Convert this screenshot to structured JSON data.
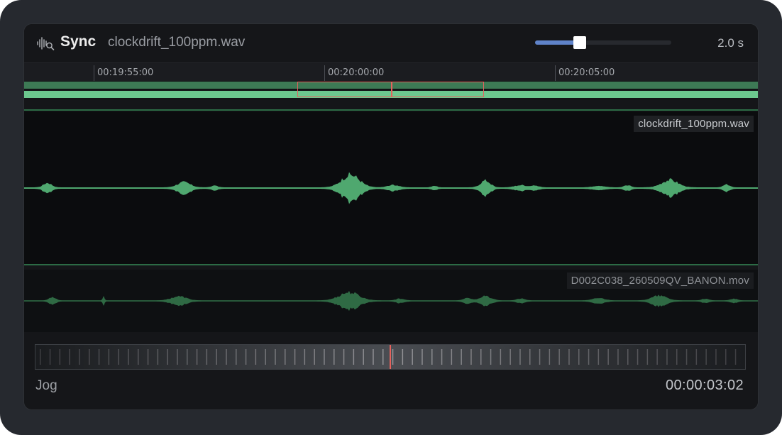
{
  "header": {
    "icon": "waveform-search-icon",
    "title": "Sync",
    "filename": "clockdrift_100ppm.wav",
    "zoom_value": "2.0 s",
    "zoom_level": 0.33
  },
  "ruler": {
    "ticks": [
      "00:19:55:00",
      "00:20:00:00",
      "00:20:05:00"
    ]
  },
  "tracks": [
    {
      "label": "clockdrift_100ppm.wav"
    },
    {
      "label": "D002C038_260509QV_BANON.mov"
    }
  ],
  "jog": {
    "label": "Jog",
    "timecode": "00:00:03:02"
  },
  "colors": {
    "waveform_primary": "#4fa86f",
    "waveform_secondary": "#2f6a44",
    "selection": "#e5625d",
    "accent": "#5f83c9"
  }
}
